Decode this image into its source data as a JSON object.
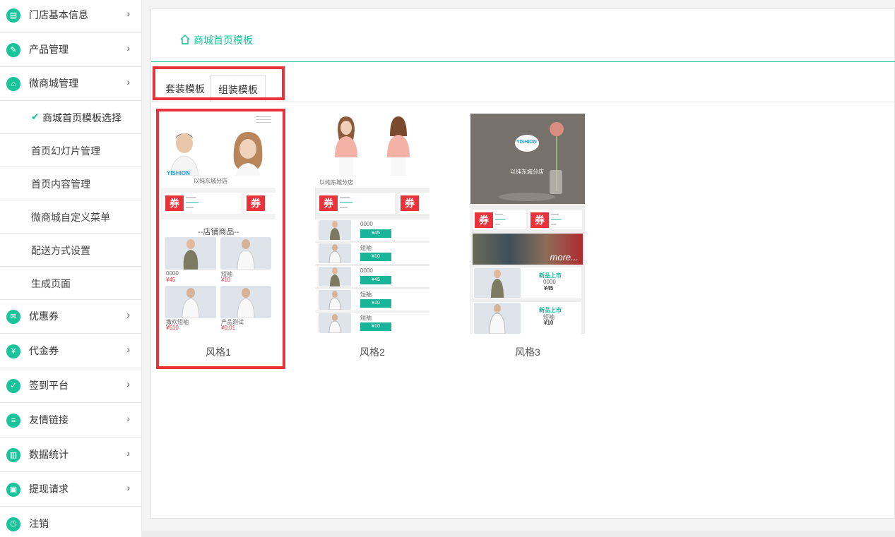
{
  "sidebar": {
    "items": [
      {
        "label": "门店基本信息",
        "icon": "document-icon",
        "arrow": "›"
      },
      {
        "label": "产品管理",
        "icon": "tag-icon",
        "arrow": "›"
      },
      {
        "label": "微商城管理",
        "icon": "store-icon",
        "arrow": "›"
      }
    ],
    "sub_items": [
      {
        "label": "商城首页模板选择",
        "check": "✔"
      },
      {
        "label": "首页幻灯片管理"
      },
      {
        "label": "首页内容管理"
      },
      {
        "label": "微商城自定义菜单"
      },
      {
        "label": "配送方式设置"
      },
      {
        "label": "生成页面"
      }
    ],
    "items2": [
      {
        "label": "优惠券",
        "icon": "coupon-icon",
        "arrow": "›"
      },
      {
        "label": "代金券",
        "icon": "voucher-icon",
        "arrow": "›"
      },
      {
        "label": "签到平台",
        "icon": "checkin-icon",
        "arrow": "›"
      },
      {
        "label": "友情链接",
        "icon": "link-icon",
        "arrow": "›"
      },
      {
        "label": "数据统计",
        "icon": "chart-icon",
        "arrow": "›"
      },
      {
        "label": "提现请求",
        "icon": "wallet-icon",
        "arrow": "›"
      },
      {
        "label": "注销",
        "icon": "power-icon"
      }
    ]
  },
  "breadcrumb": {
    "label": "商城首页模板"
  },
  "tabs": [
    {
      "label": "套装模板"
    },
    {
      "label": "组装模板"
    }
  ],
  "templates": [
    {
      "label": "风格1",
      "store": "以纯东城分店",
      "coupon_mark": "券",
      "section_title": "--店铺商品--",
      "products": [
        {
          "name": "0000",
          "price": "¥45"
        },
        {
          "name": "短袖",
          "price": "¥10"
        },
        {
          "name": "撒欢短袖",
          "price": "¥510"
        },
        {
          "name": "产品测试",
          "price": "¥0.01"
        }
      ]
    },
    {
      "label": "风格2",
      "store": "以纯东城分店",
      "coupon_mark": "券",
      "rows": [
        {
          "name": "0000",
          "price": "¥45"
        },
        {
          "name": "短袖",
          "price": "¥10"
        },
        {
          "name": "0000",
          "price": "¥45"
        },
        {
          "name": "短袖",
          "price": "¥10"
        },
        {
          "name": "短袖",
          "price": "¥10"
        }
      ]
    },
    {
      "label": "风格3",
      "store": "以纯东城分店",
      "logo": "YISHION",
      "coupon_mark": "券",
      "banner": "more...",
      "items": [
        {
          "tag": "新品上市",
          "name": "0000",
          "price": "¥45"
        },
        {
          "tag": "新品上市",
          "name": "短袖",
          "price": "¥10"
        }
      ]
    }
  ],
  "colors": {
    "accent": "#19c49a",
    "highlight": "#e8333a"
  }
}
